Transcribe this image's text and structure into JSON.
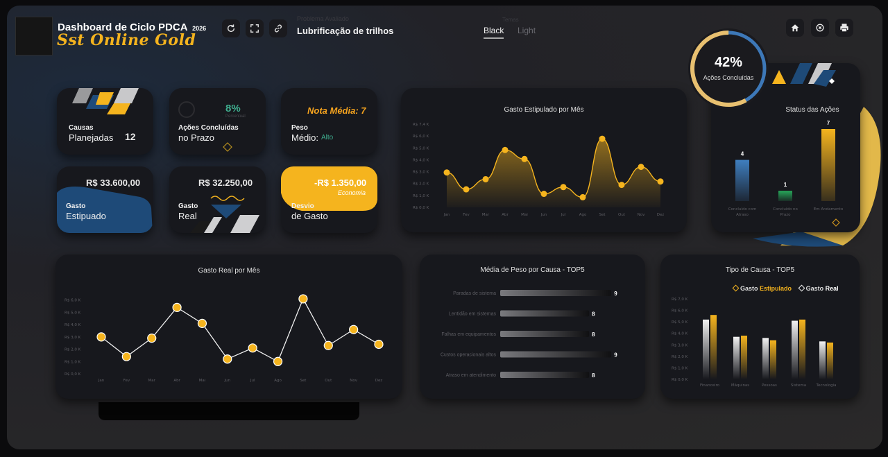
{
  "header": {
    "title": "Dashboard de Ciclo PDCA",
    "year": "2026",
    "subtitle": "Sst Online Gold",
    "problem_label": "Problema Avaliado",
    "problem_value": "Lubrificação de trilhos",
    "theme_label": "Temas",
    "theme_black": "Black",
    "theme_light": "Light",
    "icons": [
      "refresh-icon",
      "expand-icon",
      "link-icon",
      "home-icon",
      "sync-icon",
      "print-icon"
    ]
  },
  "progress": {
    "value": "42%",
    "label": "Ações Concluídas",
    "fraction": 0.42
  },
  "kpis": {
    "causas": {
      "line1": "Causas",
      "line2": "Planejadas",
      "value": "12"
    },
    "acoes": {
      "pct": "8%",
      "pct_label": "Percentual",
      "line1": "Ações Concluídas",
      "line2": "no Prazo",
      "fraction": 0.08
    },
    "peso": {
      "nota": "Nota Média: 7",
      "line1": "Peso",
      "line2": "Médio:",
      "level": "Alto"
    },
    "gasto_est": {
      "value": "R$ 33.600,00",
      "line1": "Gasto",
      "line2": "Estipuado"
    },
    "gasto_real": {
      "value": "R$ 32.250,00",
      "line1": "Gasto",
      "line2": "Real"
    },
    "desvio": {
      "value": "-R$ 1.350,00",
      "tag": "Economia",
      "line1": "Desvio",
      "line2": "de Gasto"
    }
  },
  "colors": {
    "accent": "#f5b41e",
    "blue": "#3f7fc0",
    "green": "#27a85a",
    "card": "#17181d",
    "green_text": "#3fae8f"
  },
  "chart_data": [
    {
      "type": "area",
      "title": "Gasto Estipulado por Mês",
      "categories": [
        "Jan",
        "Fev",
        "Mar",
        "Abr",
        "Mai",
        "Jun",
        "Jul",
        "Ago",
        "Set",
        "Out",
        "Nov",
        "Dez"
      ],
      "values": [
        3.1,
        1.6,
        2.5,
        5.1,
        4.3,
        1.2,
        1.8,
        0.9,
        6.1,
        2.0,
        3.6,
        2.3
      ],
      "ylim": [
        0,
        7.4
      ],
      "yticks": [
        "R$ 0,0 K",
        "R$ 1,0 K",
        "R$ 2,0 K",
        "R$ 3,0 K",
        "R$ 4,0 K",
        "R$ 5,0 K",
        "R$ 6,0 K",
        "R$ 7,4 K"
      ]
    },
    {
      "type": "bar",
      "title": "Status das Ações",
      "categories": [
        "Concluído com Atraso",
        "Concluído no Prazo",
        "Em Andamento"
      ],
      "values": [
        4,
        1,
        7
      ],
      "colors": [
        "#3f7fc0",
        "#27a85a",
        "#f5b41e"
      ]
    },
    {
      "type": "line",
      "title": "Gasto Real por Mês",
      "categories": [
        "Jan",
        "Fev",
        "Mar",
        "Abr",
        "Mai",
        "Jun",
        "Jul",
        "Ago",
        "Set",
        "Out",
        "Nov",
        "Dez"
      ],
      "values": [
        3.0,
        1.4,
        2.9,
        5.4,
        4.1,
        1.2,
        2.1,
        1.0,
        6.1,
        2.3,
        3.6,
        2.4
      ],
      "ylim": [
        0,
        7.0
      ],
      "yticks": [
        "R$ 0,0 K",
        "R$ 1,0 K",
        "R$ 2,0 K",
        "R$ 3,0 K",
        "R$ 4,0 K",
        "R$ 5,0 K",
        "R$ 6,0 K"
      ]
    },
    {
      "type": "bar",
      "title": "Média de Peso por Causa - TOP5",
      "categories": [
        "Paradas de sistema",
        "Lentidão em sistemas",
        "Falhas em equipamentos",
        "Custos operacionais altos",
        "Atraso em atendimento"
      ],
      "values": [
        9,
        8,
        8,
        9,
        8
      ],
      "xlim": [
        0,
        10
      ]
    },
    {
      "type": "bar",
      "title": "Tipo de Causa - TOP5",
      "categories": [
        "Financeiro",
        "Máquinas",
        "Pessoas",
        "Sistema",
        "Tecnologia"
      ],
      "series": [
        {
          "name": "Gasto Estipulado",
          "values": [
            5.6,
            3.8,
            3.4,
            5.2,
            3.2
          ]
        },
        {
          "name": "Gasto Real",
          "values": [
            5.2,
            3.7,
            3.6,
            5.1,
            3.3
          ]
        }
      ],
      "legend": {
        "prefix": "Gasto",
        "est": "Estipulado",
        "real": "Real"
      },
      "ylim": [
        0,
        7.0
      ],
      "yticks": [
        "R$ 0,0 K",
        "R$ 1,0 K",
        "R$ 2,0 K",
        "R$ 3,0 K",
        "R$ 4,0 K",
        "R$ 5,0 K",
        "R$ 6,0 K",
        "R$ 7,0 K"
      ]
    }
  ]
}
